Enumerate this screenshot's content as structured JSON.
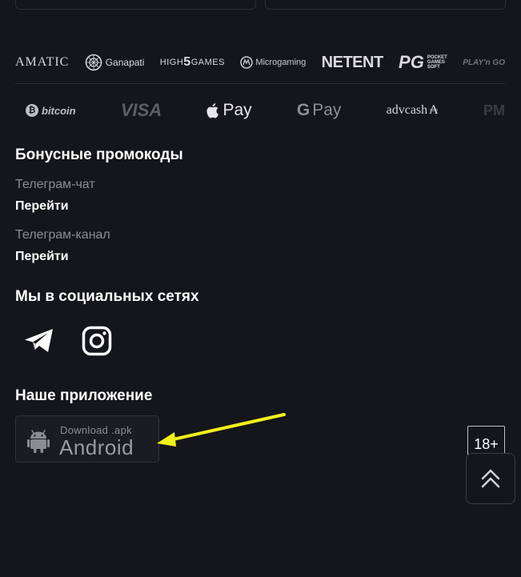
{
  "providers": {
    "amatic": "AMATIC",
    "ganapati": "Ganapati",
    "highgames_a": "HIGH",
    "highgames_b": "5",
    "highgames_c": "GAMES",
    "microgaming": "Microgaming",
    "netent": "NETENT",
    "pg_big": "PG",
    "pg_small_1": "POCKET",
    "pg_small_2": "GAMES",
    "pg_small_3": "SOFT",
    "playngo": "PLAY'n GO"
  },
  "payments": {
    "bitcoin_symbol": "₿",
    "bitcoin": "bitcoin",
    "visa": "VISA",
    "applepay_symbol": "",
    "applepay": "Pay",
    "gpay_g": "G",
    "gpay": "Pay",
    "advcash": "advcash",
    "advcash_symbol": "₳",
    "pm": "PM"
  },
  "promo": {
    "heading": "Бонусные промокоды",
    "chat_label": "Телеграм-чат",
    "chat_link": "Перейти",
    "channel_label": "Телеграм-канал",
    "channel_link": "Перейти"
  },
  "social": {
    "heading": "Мы в социальных сетях",
    "icons": [
      "telegram-icon",
      "instagram-icon"
    ]
  },
  "app": {
    "heading": "Наше приложение",
    "download_small": "Download .apk",
    "download_big": "Android"
  },
  "badge": {
    "age": "18+"
  },
  "colors": {
    "background": "#15161c",
    "annotation_arrow": "#f2f01a",
    "muted_text": "#8c8d93"
  }
}
